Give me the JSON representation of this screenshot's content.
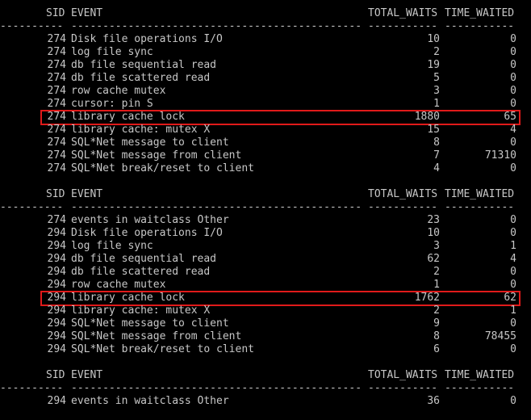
{
  "header": {
    "sid": "SID",
    "event": "EVENT",
    "total_waits": "TOTAL_WAITS",
    "time_waited": "TIME_WAITED",
    "dash_sid": "----------",
    "dash_event": "----------------------------------------------------------------",
    "dash_waits": "-----------",
    "dash_time": "-----------"
  },
  "colors": {
    "background": "#000000",
    "text": "#c7c7c7",
    "highlight": "#e01a1a"
  },
  "blocks": [
    {
      "rows": [
        {
          "sid": "274",
          "event": "Disk file operations I/O",
          "total_waits": "10",
          "time_waited": "0"
        },
        {
          "sid": "274",
          "event": "log file sync",
          "total_waits": "2",
          "time_waited": "0"
        },
        {
          "sid": "274",
          "event": "db file sequential read",
          "total_waits": "19",
          "time_waited": "0"
        },
        {
          "sid": "274",
          "event": "db file scattered read",
          "total_waits": "5",
          "time_waited": "0"
        },
        {
          "sid": "274",
          "event": "row cache mutex",
          "total_waits": "3",
          "time_waited": "0"
        },
        {
          "sid": "274",
          "event": "cursor: pin S",
          "total_waits": "1",
          "time_waited": "0"
        },
        {
          "sid": "274",
          "event": "library cache lock",
          "total_waits": "1880",
          "time_waited": "65",
          "highlighted": true
        },
        {
          "sid": "274",
          "event": "library cache: mutex X",
          "total_waits": "15",
          "time_waited": "4"
        },
        {
          "sid": "274",
          "event": "SQL*Net message to client",
          "total_waits": "8",
          "time_waited": "0"
        },
        {
          "sid": "274",
          "event": "SQL*Net message from client",
          "total_waits": "7",
          "time_waited": "71310"
        },
        {
          "sid": "274",
          "event": "SQL*Net break/reset to client",
          "total_waits": "4",
          "time_waited": "0"
        }
      ]
    },
    {
      "rows": [
        {
          "sid": "274",
          "event": "events in waitclass Other",
          "total_waits": "23",
          "time_waited": "0"
        },
        {
          "sid": "294",
          "event": "Disk file operations I/O",
          "total_waits": "10",
          "time_waited": "0"
        },
        {
          "sid": "294",
          "event": "log file sync",
          "total_waits": "3",
          "time_waited": "1"
        },
        {
          "sid": "294",
          "event": "db file sequential read",
          "total_waits": "62",
          "time_waited": "4"
        },
        {
          "sid": "294",
          "event": "db file scattered read",
          "total_waits": "2",
          "time_waited": "0"
        },
        {
          "sid": "294",
          "event": "row cache mutex",
          "total_waits": "1",
          "time_waited": "0"
        },
        {
          "sid": "294",
          "event": "library cache lock",
          "total_waits": "1762",
          "time_waited": "62",
          "highlighted": true
        },
        {
          "sid": "294",
          "event": "library cache: mutex X",
          "total_waits": "2",
          "time_waited": "1"
        },
        {
          "sid": "294",
          "event": "SQL*Net message to client",
          "total_waits": "9",
          "time_waited": "0"
        },
        {
          "sid": "294",
          "event": "SQL*Net message from client",
          "total_waits": "8",
          "time_waited": "78455"
        },
        {
          "sid": "294",
          "event": "SQL*Net break/reset to client",
          "total_waits": "6",
          "time_waited": "0"
        }
      ]
    },
    {
      "rows": [
        {
          "sid": "294",
          "event": "events in waitclass Other",
          "total_waits": "36",
          "time_waited": "0"
        }
      ]
    }
  ]
}
